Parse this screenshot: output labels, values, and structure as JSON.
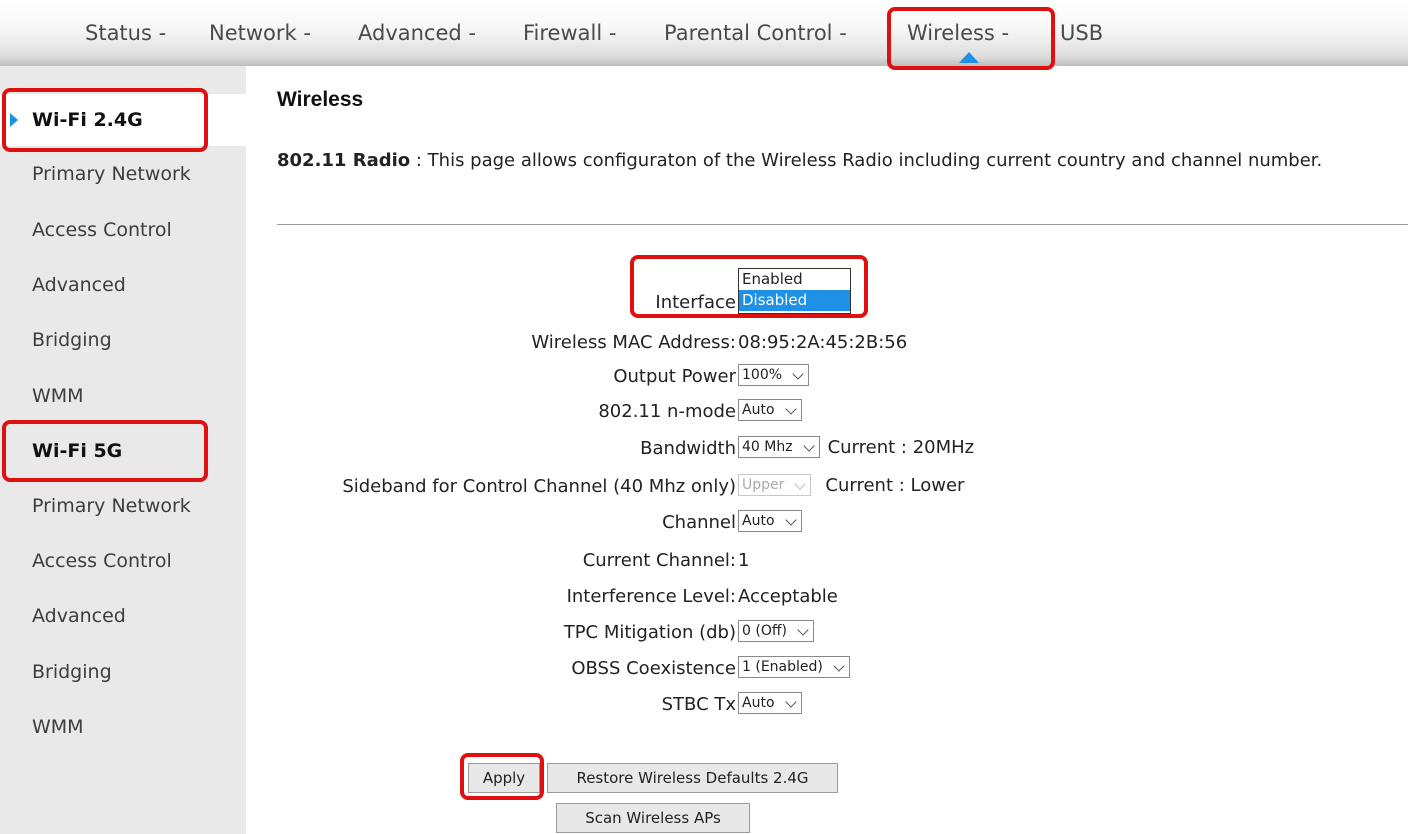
{
  "topnav": {
    "items": [
      "Status -",
      "Network -",
      "Advanced -",
      "Firewall -",
      "Parental Control -",
      "Wireless -",
      "USB"
    ],
    "active": "Wireless -"
  },
  "sidebar": {
    "items": [
      {
        "label": "Wi-Fi 2.4G",
        "type": "section",
        "active": true
      },
      {
        "label": "Primary Network",
        "type": "link"
      },
      {
        "label": "Access Control",
        "type": "link"
      },
      {
        "label": "Advanced",
        "type": "link"
      },
      {
        "label": "Bridging",
        "type": "link"
      },
      {
        "label": "WMM",
        "type": "link"
      },
      {
        "label": "Wi-Fi 5G",
        "type": "section"
      },
      {
        "label": "Primary Network",
        "type": "link"
      },
      {
        "label": "Access Control",
        "type": "link"
      },
      {
        "label": "Advanced",
        "type": "link"
      },
      {
        "label": "Bridging",
        "type": "link"
      },
      {
        "label": "WMM",
        "type": "link"
      }
    ]
  },
  "page": {
    "title": "Wireless",
    "desc_bold": "802.11 Radio",
    "desc_text": " :  This page allows configuraton of the Wireless Radio including current country and channel number."
  },
  "form": {
    "interface": {
      "label": "Interface",
      "options": [
        "Enabled",
        "Disabled"
      ],
      "selected": "Disabled"
    },
    "mac": {
      "label": "Wireless MAC Address:",
      "value": "08:95:2A:45:2B:56"
    },
    "output_power": {
      "label": "Output Power",
      "value": "100%"
    },
    "n_mode": {
      "label": "802.11 n-mode",
      "value": "Auto"
    },
    "bandwidth": {
      "label": "Bandwidth",
      "value": "40 Mhz",
      "current": "Current :  20MHz"
    },
    "sideband": {
      "label": "Sideband for Control Channel (40 Mhz only)",
      "value": "Upper",
      "current": "Current : Lower"
    },
    "channel": {
      "label": "Channel",
      "value": "Auto"
    },
    "current_channel": {
      "label": "Current Channel:",
      "value": "1"
    },
    "interference": {
      "label": "Interference Level:",
      "value": "Acceptable"
    },
    "tpc": {
      "label": "TPC Mitigation (db)",
      "value": "0 (Off)"
    },
    "obss": {
      "label": "OBSS Coexistence",
      "value": "1 (Enabled)"
    },
    "stbc": {
      "label": "STBC Tx",
      "value": "Auto"
    }
  },
  "buttons": {
    "apply": "Apply",
    "restore": "Restore Wireless Defaults 2.4G",
    "scan": "Scan Wireless APs"
  },
  "colors": {
    "accent": "#1e90e6",
    "highlight": "#e01010"
  }
}
